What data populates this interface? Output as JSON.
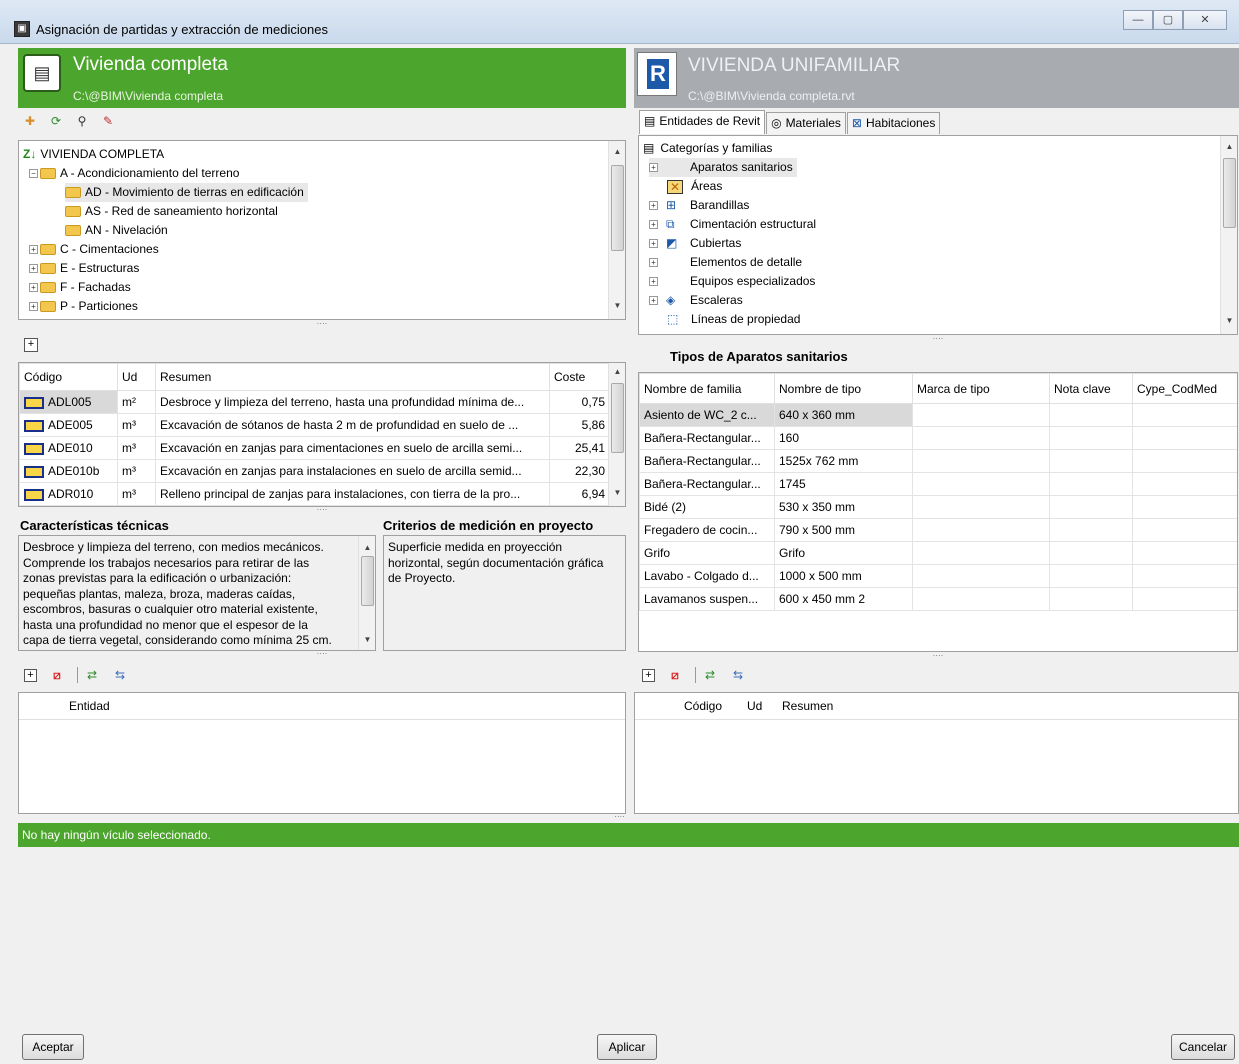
{
  "window": {
    "title": "Asignación de partidas y extracción de mediciones",
    "app_icon": "app-icon"
  },
  "left_header": {
    "title": "Vivienda completa",
    "path": "C:\\@BIM\\Vivienda completa"
  },
  "right_header": {
    "title": "VIVIENDA UNIFAMILIAR",
    "path": "C:\\@BIM\\Vivienda completa.rvt"
  },
  "left_tree": {
    "root": "VIVIENDA COMPLETA",
    "items": [
      {
        "label": "A - Acondicionamiento del terreno"
      },
      {
        "label": "AD - Movimiento de tierras en edificación"
      },
      {
        "label": "AS - Red de saneamiento horizontal"
      },
      {
        "label": "AN - Nivelación"
      },
      {
        "label": "C - Cimentaciones"
      },
      {
        "label": "E - Estructuras"
      },
      {
        "label": "F - Fachadas"
      },
      {
        "label": "P - Particiones"
      }
    ]
  },
  "items_table": {
    "headers": [
      "Código",
      "Ud",
      "Resumen",
      "Coste"
    ],
    "rows": [
      {
        "code": "ADL005",
        "ud": "m²",
        "summary": "Desbroce y limpieza del terreno, hasta una profundidad mínima de...",
        "cost": "0,75"
      },
      {
        "code": "ADE005",
        "ud": "m³",
        "summary": "Excavación de sótanos de hasta 2 m de profundidad en suelo de ...",
        "cost": "5,86"
      },
      {
        "code": "ADE010",
        "ud": "m³",
        "summary": "Excavación en zanjas para cimentaciones en suelo de arcilla semi...",
        "cost": "25,41"
      },
      {
        "code": "ADE010b",
        "ud": "m³",
        "summary": "Excavación en zanjas para instalaciones en suelo de arcilla semid...",
        "cost": "22,30"
      },
      {
        "code": "ADR010",
        "ud": "m³",
        "summary": "Relleno principal de zanjas para instalaciones, con tierra de la pro...",
        "cost": "6,94"
      }
    ]
  },
  "tech": {
    "title": "Características técnicas",
    "lines": [
      "Desbroce y limpieza del terreno, con medios mecánicos.",
      "Comprende los trabajos necesarios para retirar de las",
      "zonas previstas para la edificación o urbanización:",
      "pequeñas plantas, maleza, broza, maderas caídas,",
      "escombros, basuras o cualquier otro material existente,",
      "hasta una profundidad no menor que el espesor de la",
      "capa de tierra vegetal, considerando como mínima 25 cm."
    ]
  },
  "criteria": {
    "title": "Criterios de medición en proyecto",
    "lines": [
      "Superficie medida en proyección",
      "horizontal, según documentación gráfica",
      "de Proyecto."
    ]
  },
  "left_bottom": {
    "header": "Entidad"
  },
  "right_tabs": [
    "Entidades de Revit",
    "Materiales",
    "Habitaciones"
  ],
  "right_tree": {
    "root": "Categorías y familias",
    "items": [
      {
        "label": "Aparatos sanitarios"
      },
      {
        "label": "Áreas"
      },
      {
        "label": "Barandillas"
      },
      {
        "label": "Cimentación estructural"
      },
      {
        "label": "Cubiertas"
      },
      {
        "label": "Elementos de detalle"
      },
      {
        "label": "Equipos especializados"
      },
      {
        "label": "Escaleras"
      },
      {
        "label": "Líneas de propiedad"
      }
    ]
  },
  "types": {
    "title": "Tipos de Aparatos sanitarios",
    "headers": [
      "Nombre de familia",
      "Nombre de tipo",
      "Marca de tipo",
      "Nota clave",
      "Cype_CodMed"
    ],
    "rows": [
      {
        "family": "Asiento de WC_2 c...",
        "type": "640 x 360 mm"
      },
      {
        "family": "Bañera-Rectangular...",
        "type": "160"
      },
      {
        "family": "Bañera-Rectangular...",
        "type": "1525x 762 mm"
      },
      {
        "family": "Bañera-Rectangular...",
        "type": "1745"
      },
      {
        "family": "Bidé (2)",
        "type": "530 x 350 mm"
      },
      {
        "family": "Fregadero de cocin...",
        "type": "790 x 500 mm"
      },
      {
        "family": "Grifo",
        "type": "Grifo"
      },
      {
        "family": "Lavabo - Colgado d...",
        "type": "1000 x 500 mm"
      },
      {
        "family": "Lavamanos suspen...",
        "type": "600 x 450 mm 2"
      }
    ]
  },
  "right_bottom": {
    "headers": [
      "Código",
      "Ud",
      "Resumen"
    ]
  },
  "status": {
    "text": "No hay ningún vículo seleccionado."
  },
  "buttons": {
    "accept": "Aceptar",
    "apply": "Aplicar",
    "cancel": "Cancelar"
  },
  "colors": {
    "green": "#4ca52c",
    "gray_header": "#a8acb0"
  }
}
